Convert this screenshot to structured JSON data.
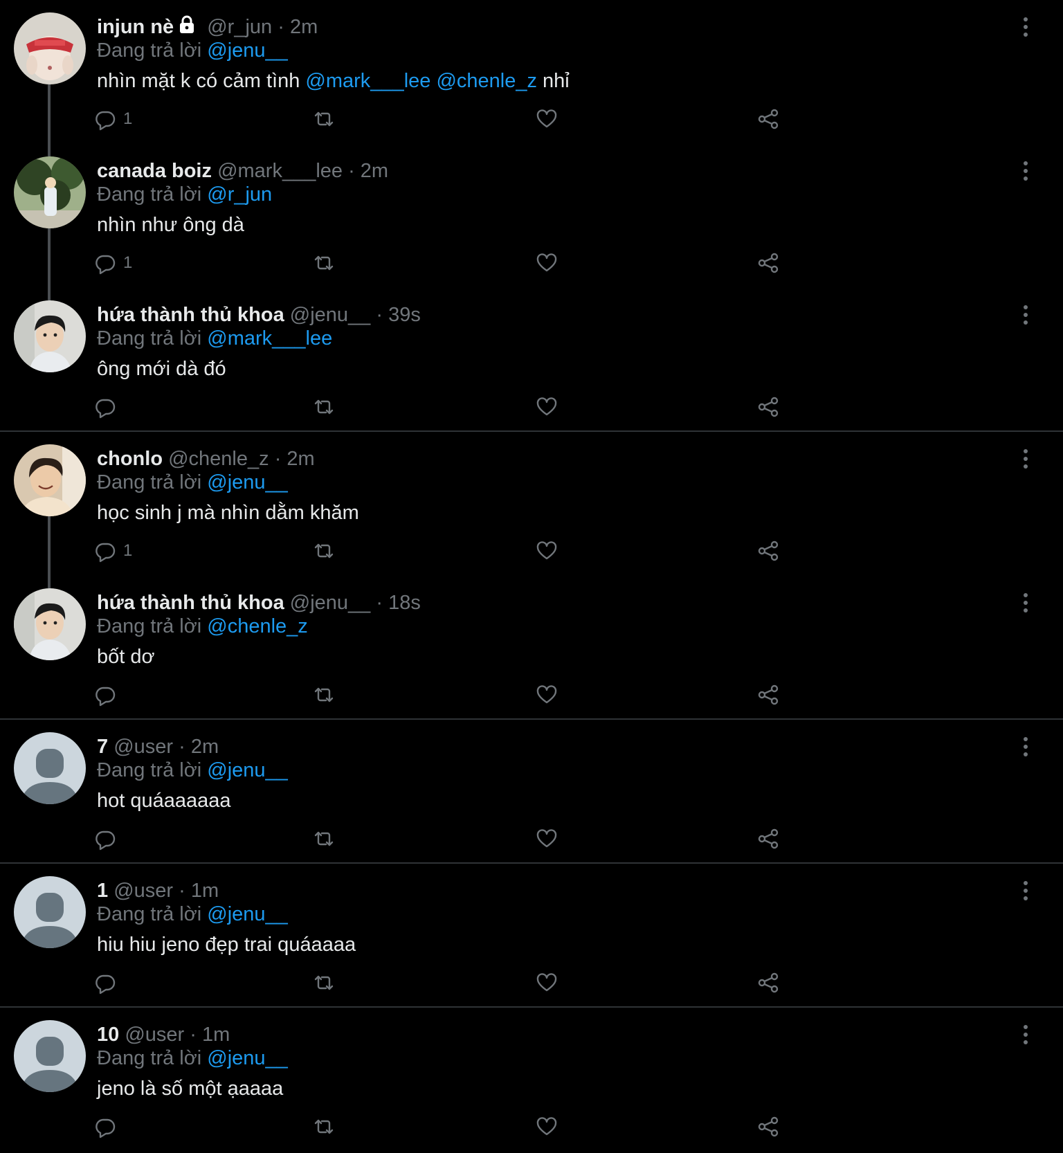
{
  "colors": {
    "background": "#000000",
    "text": "#e7e9ea",
    "muted": "#71767b",
    "mention": "#1d9bf0",
    "divider": "#2f3336",
    "thread_line": "#4a4e52"
  },
  "reply_prefix": "Đang trả lời",
  "tweets": [
    {
      "avatar": "avatar-injun",
      "name": "injun nè",
      "locked": true,
      "handle": "@r_jun",
      "time": "· 2m",
      "reply_to": "@jenu__",
      "body": [
        {
          "text": "nhìn mặt k có cảm tình "
        },
        {
          "text": "@mark___lee",
          "mention": true
        },
        {
          "text": " "
        },
        {
          "text": "@chenle_z",
          "mention": true
        },
        {
          "text": " nhỉ"
        }
      ],
      "reply_count": "1"
    },
    {
      "avatar": "avatar-canada-boiz",
      "name": "canada boiz",
      "handle": "@mark___lee",
      "time": "· 2m",
      "reply_to": "@r_jun",
      "body": [
        {
          "text": "nhìn như ông dà"
        }
      ],
      "reply_count": "1"
    },
    {
      "avatar": "avatar-jenu",
      "name": "hứa thành thủ khoa",
      "handle": "@jenu__",
      "time": "· 39s",
      "reply_to": "@mark___lee",
      "body": [
        {
          "text": "ông mới dà đó"
        }
      ],
      "reply_count": ""
    },
    {
      "avatar": "avatar-chonlo",
      "name": "chonlo",
      "handle": "@chenle_z",
      "time": "· 2m",
      "reply_to": "@jenu__",
      "body": [
        {
          "text": "học sinh j mà nhìn dằm khăm"
        }
      ],
      "reply_count": "1"
    },
    {
      "avatar": "avatar-jenu",
      "name": "hứa thành thủ khoa",
      "handle": "@jenu__",
      "time": "· 18s",
      "reply_to": "@chenle_z",
      "body": [
        {
          "text": "bốt dơ"
        }
      ],
      "reply_count": ""
    },
    {
      "avatar": "avatar-default",
      "name": "7",
      "handle": "@user",
      "time": "· 2m",
      "reply_to": "@jenu__",
      "body": [
        {
          "text": "hot quáaaaaaa"
        }
      ],
      "reply_count": ""
    },
    {
      "avatar": "avatar-default",
      "name": "1",
      "handle": "@user",
      "time": "· 1m",
      "reply_to": "@jenu__",
      "body": [
        {
          "text": "hiu hiu jeno đẹp trai quáaaaa"
        }
      ],
      "reply_count": ""
    },
    {
      "avatar": "avatar-default",
      "name": "10",
      "handle": "@user",
      "time": "· 1m",
      "reply_to": "@jenu__",
      "body": [
        {
          "text": "jeno là số một ạaaaa"
        }
      ],
      "reply_count": ""
    }
  ]
}
